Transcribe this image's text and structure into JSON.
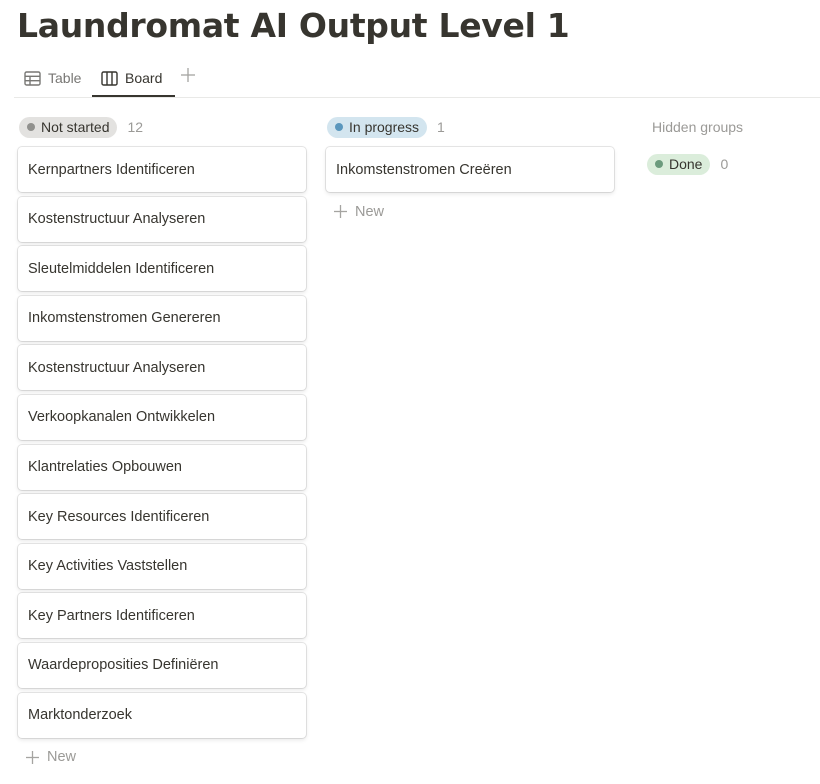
{
  "page": {
    "title": "Laundromat AI Output Level 1"
  },
  "views": {
    "tabs": [
      {
        "label": "Table",
        "icon": "table-icon",
        "active": false
      },
      {
        "label": "Board",
        "icon": "board-icon",
        "active": true
      }
    ],
    "add_icon": "plus-icon"
  },
  "colors": {
    "not_started_bg": "#e3e2e0",
    "not_started_dot": "#91918e",
    "in_progress_bg": "#d3e5ef",
    "in_progress_dot": "#5b97bd",
    "done_bg": "#dbeddb",
    "done_dot": "#6c9b7d"
  },
  "board": {
    "groups": [
      {
        "status": "Not started",
        "count": "12",
        "cards": [
          "Kernpartners Identificeren",
          "Kostenstructuur Analyseren",
          "Sleutelmiddelen Identificeren",
          "Inkomstenstromen Genereren",
          "Kostenstructuur Analyseren",
          "Verkoopkanalen Ontwikkelen",
          "Klantrelaties Opbouwen",
          "Key Resources Identificeren",
          "Key Activities Vaststellen",
          "Key Partners Identificeren",
          "Waardeproposities Definiëren",
          "Marktonderzoek"
        ],
        "new_label": "New"
      },
      {
        "status": "In progress",
        "count": "1",
        "cards": [
          "Inkomstenstromen Creëren"
        ],
        "new_label": "New"
      }
    ],
    "hidden": {
      "title": "Hidden groups",
      "groups": [
        {
          "status": "Done",
          "count": "0"
        }
      ]
    }
  }
}
